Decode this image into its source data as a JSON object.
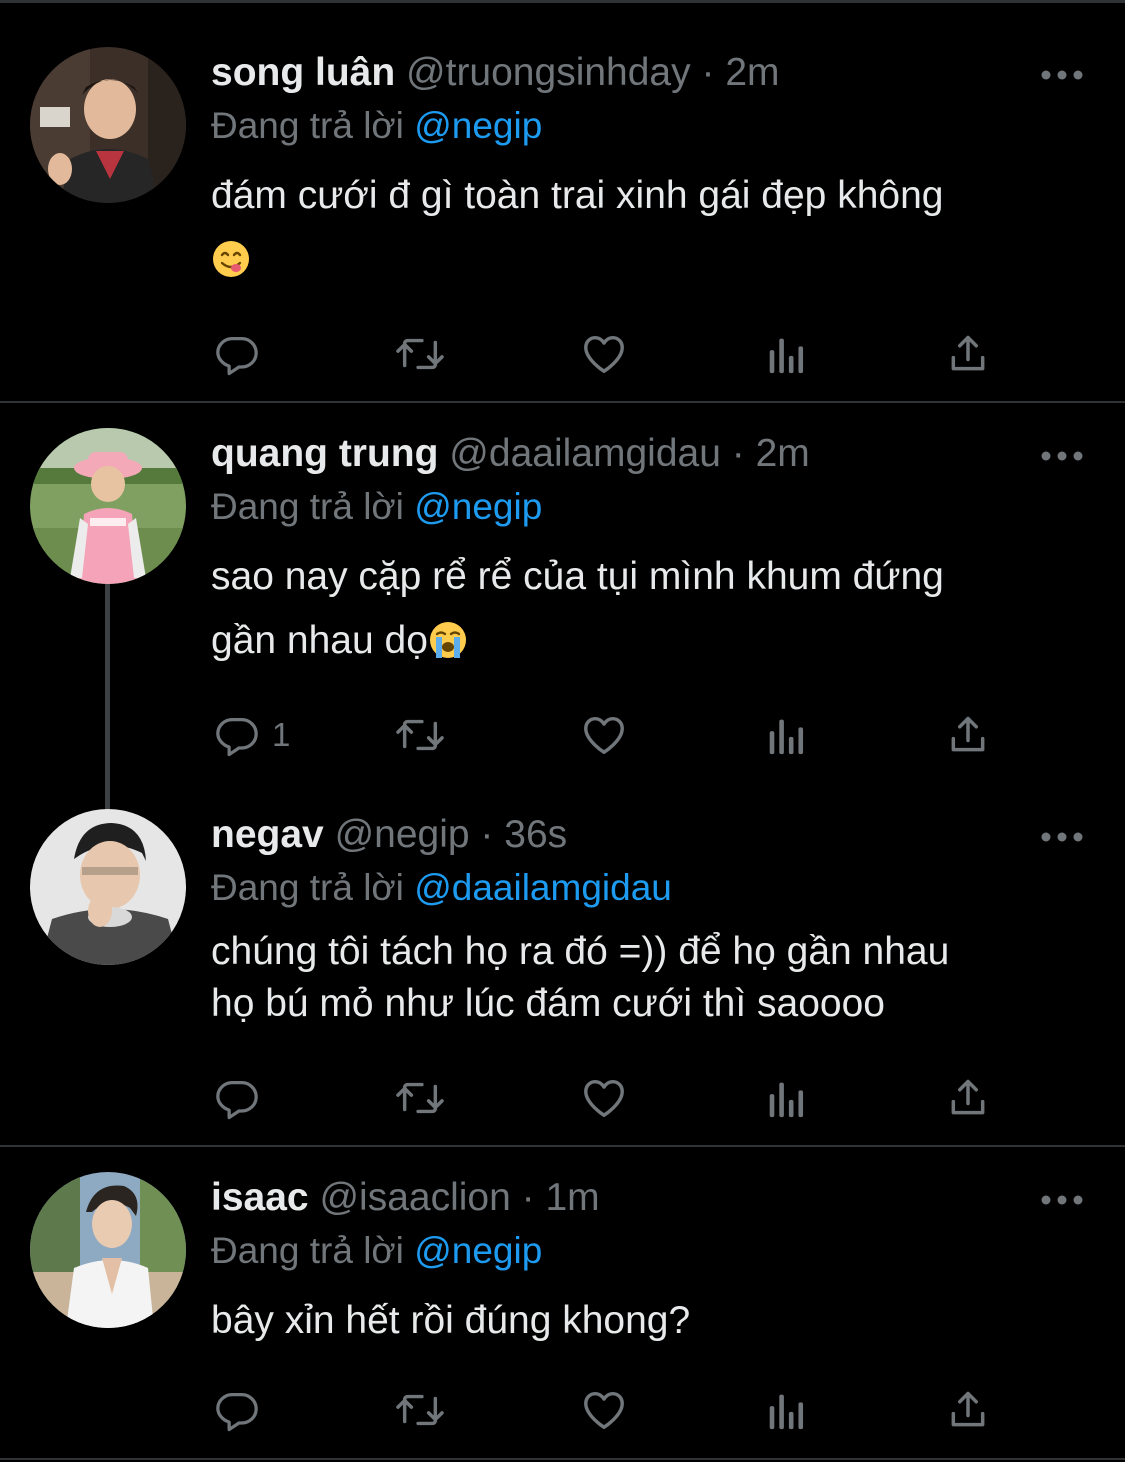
{
  "tweets": [
    {
      "name": "song luân",
      "handle": "@truongsinhday",
      "dot": "·",
      "time": "2m",
      "reply_prefix": "Đang trả lời",
      "reply_to": "@negip",
      "text": "đám cưới đ gì toàn trai xinh gái đẹp không",
      "emoji": "yum-emoji",
      "reply_count": ""
    },
    {
      "name": "quang trung",
      "handle": "@daailamgidau",
      "dot": "·",
      "time": "2m",
      "reply_prefix": "Đang trả lời",
      "reply_to": "@negip",
      "text_line1": "sao nay cặp rể rể của tụi mình khum đứng",
      "text_line2": "gần nhau dọ",
      "emoji": "crying-emoji",
      "reply_count": "1"
    },
    {
      "name": "negav",
      "handle": "@negip",
      "dot": "·",
      "time": "36s",
      "reply_prefix": "Đang trả lời",
      "reply_to": "@daailamgidau",
      "text_line1": "chúng tôi tách họ ra đó =)) để họ gần nhau",
      "text_line2": "họ bú mỏ như lúc đám cưới thì saoooo",
      "reply_count": ""
    },
    {
      "name": "isaac",
      "handle": "@isaaclion",
      "dot": "·",
      "time": "1m",
      "reply_prefix": "Đang trả lời",
      "reply_to": "@negip",
      "text": "bây xỉn hết rồi đúng khong?",
      "reply_count": ""
    }
  ],
  "icons": {
    "reply": "reply-icon",
    "retweet": "retweet-icon",
    "like": "like-icon",
    "views": "views-icon",
    "share": "share-icon",
    "more": "more-icon"
  },
  "colors": {
    "background": "#000000",
    "text": "#e7e9ea",
    "secondary": "#71767b",
    "mention": "#1d9bf0",
    "divider": "#2f3336"
  }
}
